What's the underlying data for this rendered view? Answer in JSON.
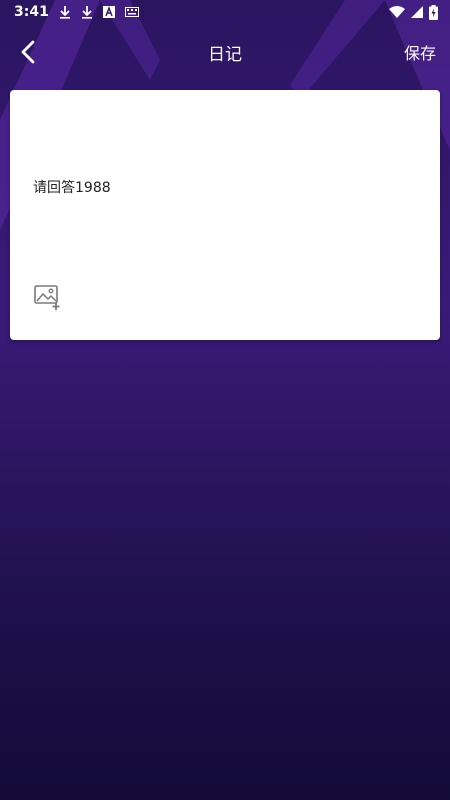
{
  "status_bar": {
    "time": "3:41",
    "left_icons": [
      "download-icon",
      "download-icon",
      "font-a-icon",
      "keyboard-icon"
    ],
    "right_icons": [
      "wifi-icon",
      "signal-icon",
      "battery-charging-icon"
    ]
  },
  "app_bar": {
    "back_icon": "chevron-left-icon",
    "title": "日记",
    "save_label": "保存"
  },
  "editor": {
    "text": "请回答1988",
    "add_image_icon": "add-image-icon"
  },
  "colors": {
    "background_top": "#2a1560",
    "background_bottom": "#130b38",
    "accent": "#5a2aa8",
    "card": "#ffffff",
    "text_dark": "#222222"
  }
}
